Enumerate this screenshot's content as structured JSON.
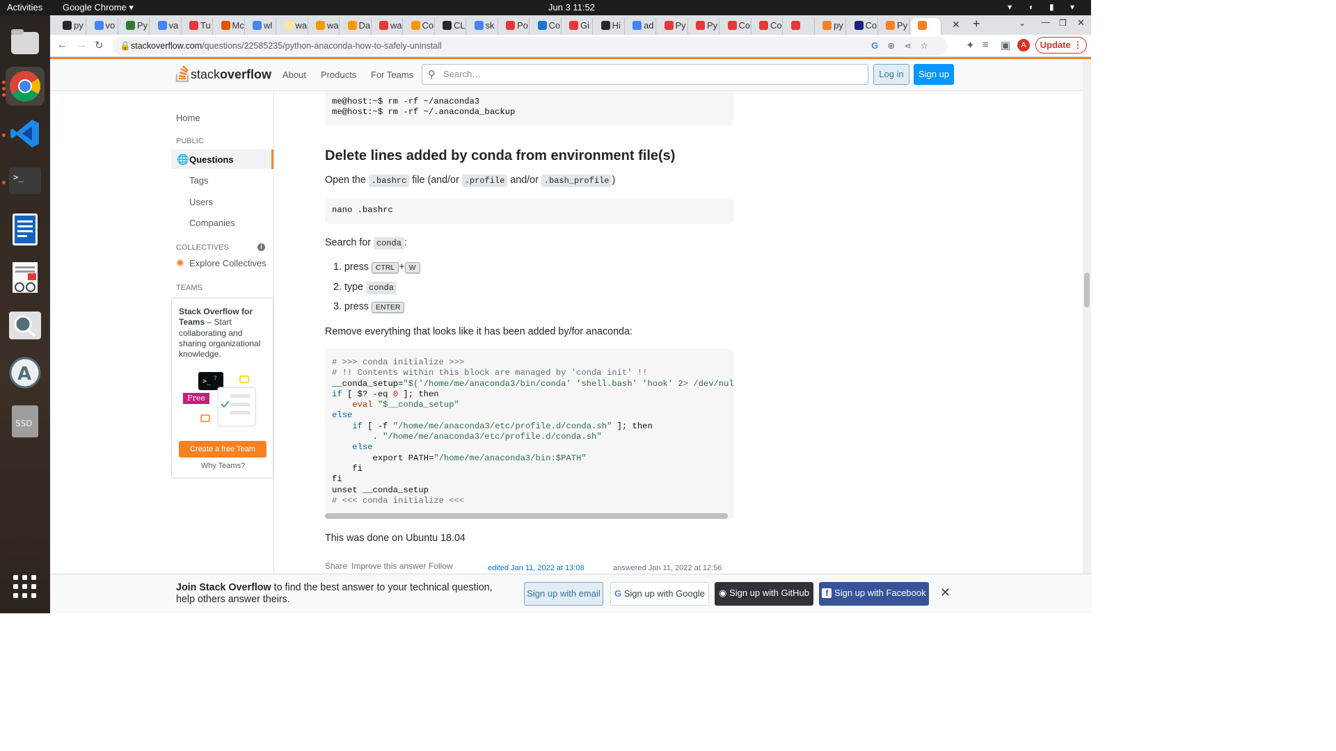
{
  "os": {
    "activities": "Activities",
    "app_menu": "Google Chrome ▾",
    "clock": "Jun 3  11:52"
  },
  "tabs": [
    {
      "label": "py",
      "color": "#24292f"
    },
    {
      "label": "vo",
      "color": "#4285f4"
    },
    {
      "label": "Py",
      "color": "#2e7d32"
    },
    {
      "label": "va",
      "color": "#4285f4"
    },
    {
      "label": "Tu",
      "color": "#e53935"
    },
    {
      "label": "Mc",
      "color": "#e65100"
    },
    {
      "label": "wl",
      "color": "#4285f4"
    },
    {
      "label": "wa",
      "color": "#f9e79f"
    },
    {
      "label": "wa",
      "color": "#ff9800"
    },
    {
      "label": "Da",
      "color": "#ff9800"
    },
    {
      "label": "wa",
      "color": "#e53935"
    },
    {
      "label": "Co",
      "color": "#ff9800"
    },
    {
      "label": "CL",
      "color": "#24292f"
    },
    {
      "label": "sk",
      "color": "#4285f4"
    },
    {
      "label": "Po",
      "color": "#e53935"
    },
    {
      "label": "Co",
      "color": "#1976d2"
    },
    {
      "label": "Gi",
      "color": "#e53935"
    },
    {
      "label": "Hi",
      "color": "#24292f"
    },
    {
      "label": "ad",
      "color": "#4285f4"
    },
    {
      "label": "Py",
      "color": "#e53935"
    },
    {
      "label": "Py",
      "color": "#e53935"
    },
    {
      "label": "Co",
      "color": "#e53935"
    },
    {
      "label": "Co",
      "color": "#e53935"
    },
    {
      "label": "",
      "color": "#e53935"
    },
    {
      "label": "py",
      "color": "#f48225"
    },
    {
      "label": "Co",
      "color": "#1a237e"
    },
    {
      "label": "Py",
      "color": "#f48225"
    },
    {
      "label": "",
      "color": "#f48225"
    }
  ],
  "address": {
    "domain": "stackoverflow.com",
    "path": "/questions/22585235/python-anaconda-how-to-safely-uninstall",
    "update": "Update",
    "avatar": "A"
  },
  "so": {
    "logo_a": "stack",
    "logo_b": "overflow",
    "nav": [
      "About",
      "Products",
      "For Teams"
    ],
    "search_placeholder": "Search…",
    "login": "Log in",
    "signup": "Sign up"
  },
  "leftnav": {
    "home": "Home",
    "public": "PUBLIC",
    "questions": "Questions",
    "tags": "Tags",
    "users": "Users",
    "companies": "Companies",
    "collectives": "COLLECTIVES",
    "explore": "Explore Collectives",
    "teams": "TEAMS",
    "teambox_title": "Stack Overflow for Teams",
    "teambox_text": " – Start collaborating and sharing organizational knowledge.",
    "free": "Free",
    "create": "Create a free Team",
    "why": "Why Teams?"
  },
  "content": {
    "code1": [
      "me@host:~$ rm -rf ~/anaconda3",
      "me@host:~$ rm -rf ~/.anaconda_backup"
    ],
    "heading": "Delete lines added by conda from environment file(s)",
    "open_pre": "Open the ",
    "bashrc": ".bashrc",
    "open_mid1": " file (and/or ",
    "profile": ".profile",
    "open_mid2": " and/or ",
    "bash_profile": ".bash_profile",
    "open_post": ")",
    "code2": "nano .bashrc",
    "search_pre": "Search for ",
    "conda": "conda",
    "search_post": ":",
    "step1": "press",
    "ctrl": "CTRL",
    "plus": "+",
    "w": "W",
    "step2": "type",
    "step3": "press",
    "enter": "ENTER",
    "remove": "Remove everything that looks like it has been added by/for anaconda:",
    "ubuntu": "This was done on Ubuntu 18.04",
    "share": "Share",
    "improve": "Improve this answer",
    "follow": "Follow",
    "edited": "edited Jan 11, 2022 at 13:08",
    "answered": "answered Jan 11, 2022 at 12:56"
  },
  "banner": {
    "bold": "Join Stack Overflow",
    "rest": " to find the best answer to your technical question, help others answer theirs.",
    "email": "Sign up with email",
    "google": "Sign up with Google",
    "github": "Sign up with GitHub",
    "facebook": "Sign up with Facebook"
  }
}
